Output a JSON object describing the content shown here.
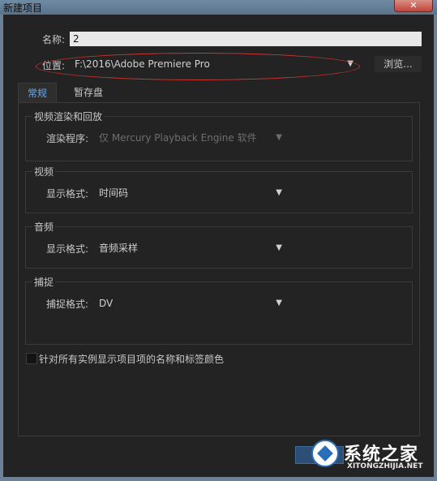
{
  "window": {
    "title": "新建项目",
    "close_label": "✕"
  },
  "form": {
    "name_label": "名称:",
    "name_value": "2",
    "location_label": "位置:",
    "location_value": "F:\\2016\\Adobe Premiere Pro",
    "browse_label": "浏览..."
  },
  "tabs": [
    {
      "label": "常规",
      "active": true
    },
    {
      "label": "暂存盘",
      "active": false
    }
  ],
  "groups": {
    "video_render": {
      "title": "视频渲染和回放",
      "renderer_label": "渲染程序:",
      "renderer_value": "仅 Mercury Playback Engine 软件"
    },
    "video": {
      "title": "视频",
      "display_label": "显示格式:",
      "display_value": "时间码"
    },
    "audio": {
      "title": "音频",
      "display_label": "显示格式:",
      "display_value": "音频采样"
    },
    "capture": {
      "title": "捕捉",
      "format_label": "捕捉格式:",
      "format_value": "DV"
    }
  },
  "checkbox": {
    "label": "针对所有实例显示项目项的名称和标签颜色",
    "checked": false
  },
  "watermark": {
    "brand": "系统之家",
    "url": "XITONGZHIJIA.NET"
  },
  "colors": {
    "accent": "#6ea8e0",
    "annotation_red": "#c9352f",
    "titlebar": "#5a738b"
  }
}
